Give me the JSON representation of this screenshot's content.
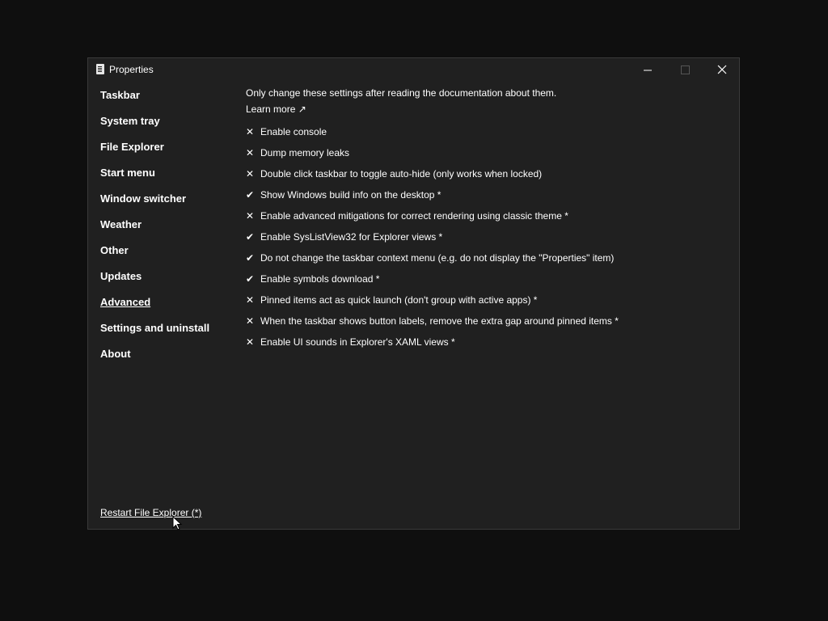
{
  "window": {
    "title": "Properties",
    "icon": "app-document-icon"
  },
  "sidebar": {
    "items": [
      {
        "label": "Taskbar",
        "active": false
      },
      {
        "label": "System tray",
        "active": false
      },
      {
        "label": "File Explorer",
        "active": false
      },
      {
        "label": "Start menu",
        "active": false
      },
      {
        "label": "Window switcher",
        "active": false
      },
      {
        "label": "Weather",
        "active": false
      },
      {
        "label": "Other",
        "active": false
      },
      {
        "label": "Updates",
        "active": false
      },
      {
        "label": "Advanced",
        "active": true
      },
      {
        "label": "Settings and uninstall",
        "active": false
      },
      {
        "label": "About",
        "active": false
      }
    ]
  },
  "main": {
    "note": "Only change these settings after reading the documentation about them.",
    "learn_more": "Learn more ↗",
    "options": [
      {
        "mark": "✕",
        "checked": false,
        "label": "Enable console"
      },
      {
        "mark": "✕",
        "checked": false,
        "label": "Dump memory leaks"
      },
      {
        "mark": "✕",
        "checked": false,
        "label": "Double click taskbar to toggle auto-hide (only works when locked)"
      },
      {
        "mark": "✔",
        "checked": true,
        "label": "Show Windows build info on the desktop *"
      },
      {
        "mark": "✕",
        "checked": false,
        "label": "Enable advanced mitigations for correct rendering using classic theme *"
      },
      {
        "mark": "✔",
        "checked": true,
        "label": "Enable SysListView32 for Explorer views *"
      },
      {
        "mark": "✔",
        "checked": true,
        "label": "Do not change the taskbar context menu (e.g. do not display the \"Properties\" item)"
      },
      {
        "mark": "✔",
        "checked": true,
        "label": "Enable symbols download *"
      },
      {
        "mark": "✕",
        "checked": false,
        "label": "Pinned items act as quick launch (don't group with active apps) *"
      },
      {
        "mark": "✕",
        "checked": false,
        "label": "When the taskbar shows button labels, remove the extra gap around pinned items *"
      },
      {
        "mark": "✕",
        "checked": false,
        "label": "Enable UI sounds in Explorer's XAML views *"
      }
    ]
  },
  "footer": {
    "restart_label": "Restart File Explorer (*)"
  }
}
